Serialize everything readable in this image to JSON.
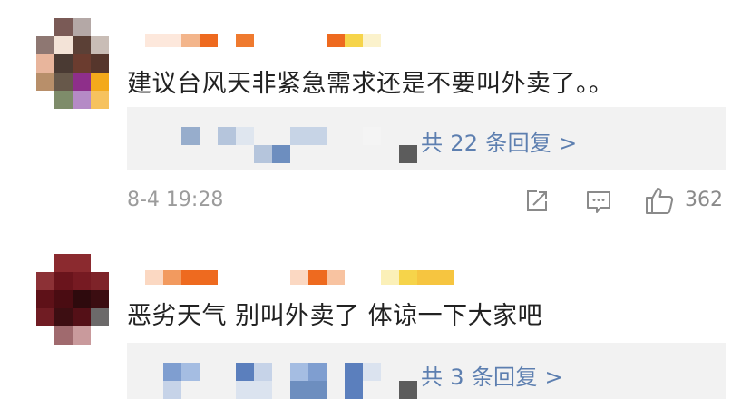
{
  "comments": [
    {
      "text": "建议台风天非紧急需求还是不要叫外卖了。。",
      "replies_link": "共 22 条回复 >",
      "timestamp": "8-4 19:28",
      "like_count": "362",
      "icons": [
        "share-icon",
        "comment-icon",
        "like-icon"
      ]
    },
    {
      "text": "恶劣天气 别叫外卖了 体谅一下大家吧",
      "replies_link": "共 3 条回复 >"
    }
  ],
  "colors": {
    "reply_link": "#5d7fb0",
    "reply_box_bg": "#f2f2f2",
    "muted_text": "#9b9b9b"
  }
}
